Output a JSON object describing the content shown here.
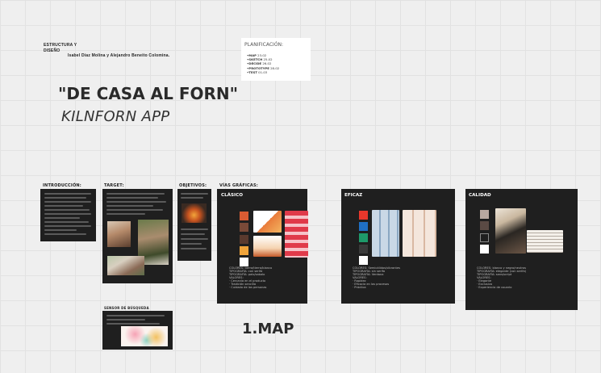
{
  "header": {
    "section_label": "ESTRUCTURA Y DISEÑO",
    "authors": "Isabel Díaz Molina y Alejandro Beneito Colomina."
  },
  "planning": {
    "title": "PLANIFICACIÓN:",
    "items": [
      {
        "label": "•MAP",
        "date": "23-02"
      },
      {
        "label": "•SKETCH",
        "date": "25-02"
      },
      {
        "label": "•DECIDE",
        "date": "26-02"
      },
      {
        "label": "•PROTOTYPE",
        "date": "28-02"
      },
      {
        "label": "•TEST",
        "date": "01-03"
      }
    ]
  },
  "project": {
    "title": "\"DE CASA AL FORN\"",
    "subtitle": "KILNFORN APP"
  },
  "sections": {
    "intro": "INTRODUCCIÓN:",
    "target": "TARGET:",
    "objetivos": "OBJETIVOS:",
    "vias": "VÍAS GRÁFICAS:",
    "sensor": "SENSOR DE BÚSQUEDA"
  },
  "vias": [
    {
      "title": "CLÁSICO",
      "swatches": [
        "#d95b32",
        "#7a4a38",
        "#5a3a2e",
        "#f0a43a",
        "#ffffff"
      ],
      "desc": [
        "COLORES: tierra/tierra/blanco",
        "TIPOGRAFÍA: con serifa",
        "TIPOGRAFÍA: palo/sabalo",
        "VALORES:",
        "· Cercanía en el producto",
        "· Tradición sencilla",
        "· Cuidado de las personas"
      ]
    },
    {
      "title": "EFICAZ",
      "swatches": [
        "#e8372b",
        "#1f6fc4",
        "#1e9a6a",
        "#3a3a3a",
        "#ffffff"
      ],
      "desc": [
        "COLORES: Semicálidos/vibrantes",
        "TIPOGRAFÍA: sin serifa",
        "TIPOGRAFÍA: Verdana",
        "VALORES:",
        "· Rapidez",
        "· Eficacia en los procesos",
        "· Práctica"
      ]
    },
    {
      "title": "CALIDAD",
      "swatches": [
        "#b8a8a0",
        "#5a4a44",
        "#ffffff"
      ],
      "desc": [
        "COLORES: blanco y negro/neutros",
        "TIPOGRAFÍA: elegante (con serifa)",
        "TIPOGRAFÍA: sans/script",
        "VALORES:",
        "· Elegante",
        "· Exclusivo",
        "· Experiencia de usuario"
      ]
    }
  ],
  "map_label": "1.MAP"
}
